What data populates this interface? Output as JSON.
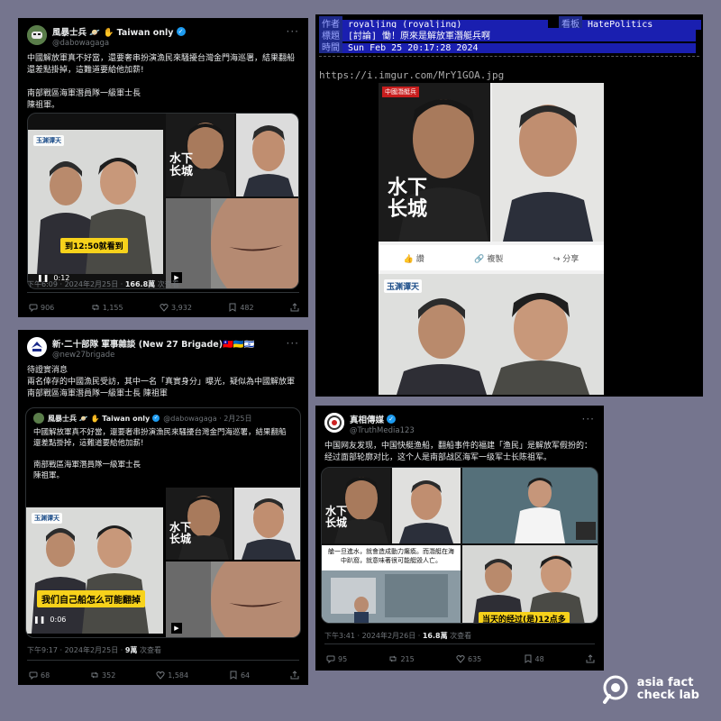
{
  "tweet1": {
    "name": "風暴士兵 🪐 ✋ Taiwan only",
    "handle": "@dabowagaga",
    "text": "中國解放軍真不好當，還要奢串扮演漁民來騷擾台灣金門海巡署，結果翻船還差點掛掉，這難道要給他加薪!\n\n南部戰區海軍潛員隊一級軍士長\n陳祖軍。",
    "caption": "到12:50就看到",
    "video_time": "0:12",
    "overlay_title": "水下\n长城",
    "logo": "玉渊谭天",
    "meta_time": "下午6:09 · 2024年2月25日 · ",
    "views": "166.8萬",
    "views_label": " 次查看",
    "stats": {
      "replies": "906",
      "retweets": "1,155",
      "likes": "3,932",
      "bookmarks": "482"
    }
  },
  "tweet2": {
    "name": "新·二十部隊 軍事雜談 (New 27 Brigade)🇹🇼🇺🇦🇮🇱",
    "handle": "@new27brigade",
    "text": "待證實消息\n兩名倖存的中國漁民受訪，其中一名「真實身分」曝光，疑似為中國解放軍\n南部戰區海軍潛員隊一級軍士長 陳祖軍",
    "quote_name": "風暴士兵 🪐 ✋ Taiwan only",
    "quote_handle": "@dabowagaga · 2月25日",
    "quote_text": "中國解放軍真不好當，還要奢串扮演漁民來騷擾台灣金門海巡署，結果翻船還差點掛掉，這難道要給他加薪!\n\n南部戰區海軍潛員隊一級軍士長\n陳祖軍。",
    "caption": "我们自己船怎么可能翻掉",
    "video_time": "0:06",
    "overlay_title": "水下\n长城",
    "logo": "玉渊谭天",
    "meta_time": "下午9:17 · 2024年2月25日 · ",
    "views": "9萬",
    "views_label": " 次查看",
    "stats": {
      "replies": "68",
      "retweets": "352",
      "likes": "1,584",
      "bookmarks": "64"
    }
  },
  "ptt": {
    "author_label": "作者",
    "author": "royaljing (royaljing)",
    "board_label": "看板",
    "board": "HatePolitics",
    "title_label": "標題",
    "title": "[討論] 慟！原來是解放軍潛艇兵啊",
    "time_label": "時間",
    "time": "Sun Feb 25 20:17:28 2024",
    "url": "https://i.imgur.com/MrY1GOA.jpg",
    "tag": "中國潛艇兵",
    "overlay_title": "水下\n长城",
    "fb_like": "讚",
    "fb_copy": "複製",
    "fb_share": "分享",
    "logo": "玉渊谭天"
  },
  "tweet3": {
    "name": "真相傳媒",
    "handle": "@TruthMedia123",
    "text": "中国网友发现，中国快艇渔船，翻船事件的福建「渔民」是解放军假扮的：经过面部轮廓对比，这个人是南部战区海军一级军士长陈祖军。",
    "overlay_title": "水下\n长城",
    "caption": "当天的经过(是)12点多",
    "sub_text": "艙一旦進水，就會造成動力癱瘓。而潛艇在海中趴窩，就意味著很可能艇毀人亡。",
    "meta_time": "下午3:41 · 2024年2月26日 · ",
    "views": "16.8萬",
    "views_label": " 次查看",
    "stats": {
      "replies": "95",
      "retweets": "215",
      "likes": "635",
      "bookmarks": "48"
    }
  },
  "watermark": {
    "line1": "asia fact",
    "line2": "check lab"
  },
  "colors": {
    "page_bg": "#75758e",
    "card_bg": "#000000",
    "verified": "#1d9bf0",
    "ptt_blue": "#1a1fb0",
    "caption_yellow": "#f7d21b"
  }
}
